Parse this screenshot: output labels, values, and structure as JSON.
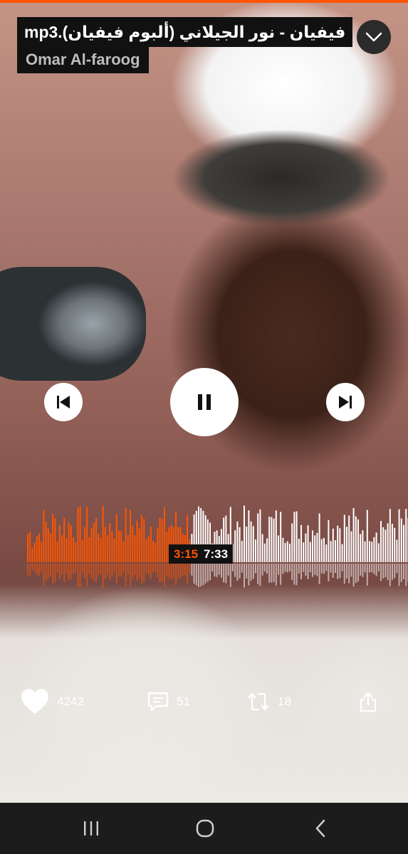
{
  "player": {
    "track_title": "فيفيان - نور الجيلاني (ألبوم فيفيان).mp3",
    "artist": "Omar Al-faroog",
    "time": {
      "current": "3:15",
      "total": "7:33"
    },
    "progress_fraction": 0.43
  },
  "actions": {
    "likes": "4242",
    "comments": "51",
    "reposts": "18"
  },
  "colors": {
    "accent": "#ff5500",
    "played_wave": "#ff5500",
    "unplayed_wave": "#ffffff",
    "label_bg": "#111111"
  },
  "icons": {
    "collapse": "chevron-down-icon",
    "previous": "skip-previous-icon",
    "pause": "pause-icon",
    "next": "skip-next-icon",
    "like": "heart-icon",
    "comment": "comment-icon",
    "repost": "repost-icon",
    "share": "share-icon",
    "nav_recents": "recents-icon",
    "nav_home": "home-icon",
    "nav_back": "back-icon"
  }
}
